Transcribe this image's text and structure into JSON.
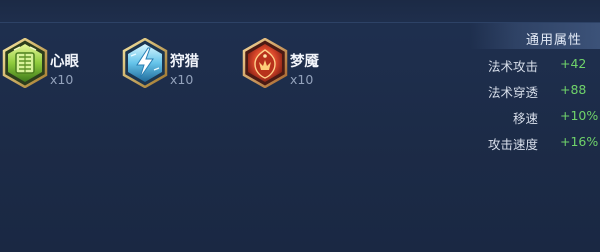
{
  "runes": [
    {
      "name": "心眼",
      "count": "x10",
      "icon": "green-gem-rune-icon",
      "color": "#7cc43a"
    },
    {
      "name": "狩猎",
      "count": "x10",
      "icon": "blue-lightning-rune-icon",
      "color": "#5fc6e8"
    },
    {
      "name": "梦魇",
      "count": "x10",
      "icon": "red-crest-rune-icon",
      "color": "#d8462a"
    }
  ],
  "stats": {
    "title": "通用属性",
    "items": [
      {
        "name": "法术攻击",
        "value": "+42"
      },
      {
        "name": "法术穿透",
        "value": "+88"
      },
      {
        "name": "移速",
        "value": "+10%"
      },
      {
        "name": "攻击速度",
        "value": "+16%"
      }
    ]
  },
  "colors": {
    "background": "#1d2c48",
    "stat_value": "#6fd36a",
    "stat_name": "#d7deea"
  }
}
